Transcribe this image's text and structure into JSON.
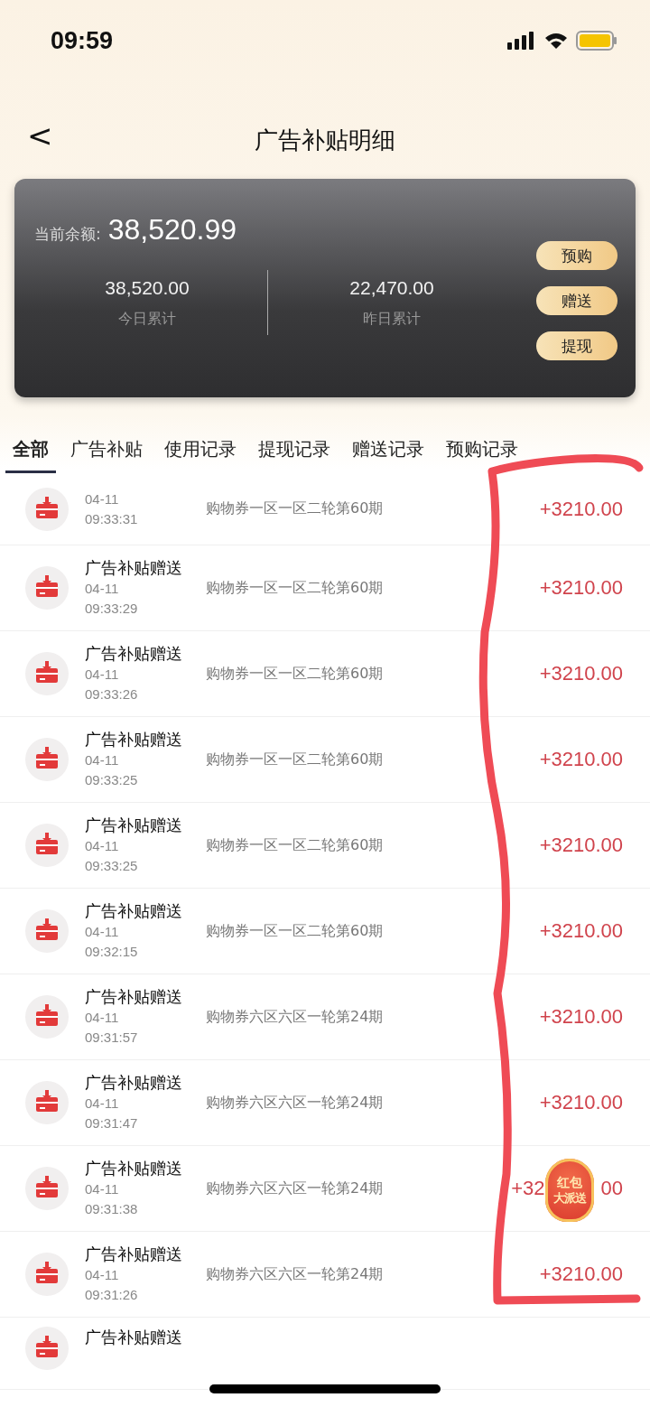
{
  "status_bar": {
    "time": "09:59"
  },
  "header": {
    "back": "<",
    "title": "广告补贴明细"
  },
  "balance_card": {
    "label": "当前余额:",
    "amount": "38,520.99",
    "stats": [
      {
        "value": "38,520.00",
        "label": "今日累计"
      },
      {
        "value": "22,470.00",
        "label": "昨日累计"
      }
    ],
    "buttons": [
      "预购",
      "赠送",
      "提现"
    ]
  },
  "tabs": [
    {
      "label": "全部",
      "selected": true
    },
    {
      "label": "广告补贴",
      "selected": false
    },
    {
      "label": "使用记录",
      "selected": false
    },
    {
      "label": "提现记录",
      "selected": false
    },
    {
      "label": "赠送记录",
      "selected": false
    },
    {
      "label": "预购记录",
      "selected": false
    }
  ],
  "records": [
    {
      "date": "04-11",
      "time": "09:33:31",
      "description": "购物券一区一区二轮第60期",
      "amount": "+3210.00"
    },
    {
      "title": "广告补贴赠送",
      "date": "04-11",
      "time": "09:33:29",
      "description": "购物券一区一区二轮第60期",
      "amount": "+3210.00"
    },
    {
      "title": "广告补贴赠送",
      "date": "04-11",
      "time": "09:33:26",
      "description": "购物券一区一区二轮第60期",
      "amount": "+3210.00"
    },
    {
      "title": "广告补贴赠送",
      "date": "04-11",
      "time": "09:33:25",
      "description": "购物券一区一区二轮第60期",
      "amount": "+3210.00"
    },
    {
      "title": "广告补贴赠送",
      "date": "04-11",
      "time": "09:33:25",
      "description": "购物券一区一区二轮第60期",
      "amount": "+3210.00"
    },
    {
      "title": "广告补贴赠送",
      "date": "04-11",
      "time": "09:32:15",
      "description": "购物券一区一区二轮第60期",
      "amount": "+3210.00"
    },
    {
      "title": "广告补贴赠送",
      "date": "04-11",
      "time": "09:31:57",
      "description": "购物券六区六区一轮第24期",
      "amount": "+3210.00"
    },
    {
      "title": "广告补贴赠送",
      "date": "04-11",
      "time": "09:31:47",
      "description": "购物券六区六区一轮第24期",
      "amount": "+3210.00"
    },
    {
      "title": "广告补贴赠送",
      "date": "04-11",
      "time": "09:31:38",
      "description": "购物券六区六区一轮第24期",
      "amount_parts": [
        "+32",
        "00"
      ]
    },
    {
      "title": "广告补贴赠送",
      "date": "04-11",
      "time": "09:31:26",
      "description": "购物券六区六区一轮第24期",
      "amount": "+3210.00"
    },
    {
      "title": "广告补贴赠送"
    }
  ],
  "floating_badge": {
    "line1": "红包",
    "line2": "大派送"
  }
}
